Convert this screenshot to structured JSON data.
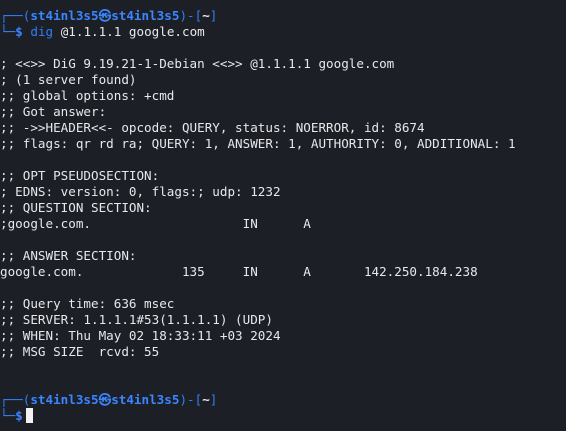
{
  "prompt": {
    "user": "st4inl3s5",
    "at_symbol": "㉿",
    "host": "st4inl3s5",
    "cwd": "~",
    "dollar": "$"
  },
  "command": {
    "binary": "dig",
    "args": " @1.1.1.1 google.com"
  },
  "output": {
    "l01": "; <<>> DiG 9.19.21-1-Debian <<>> @1.1.1.1 google.com",
    "l02": "; (1 server found)",
    "l03": ";; global options: +cmd",
    "l04": ";; Got answer:",
    "l05": ";; ->>HEADER<<- opcode: QUERY, status: NOERROR, id: 8674",
    "l06": ";; flags: qr rd ra; QUERY: 1, ANSWER: 1, AUTHORITY: 0, ADDITIONAL: 1",
    "l07": ";; OPT PSEUDOSECTION:",
    "l08": "; EDNS: version: 0, flags:; udp: 1232",
    "l09": ";; QUESTION SECTION:",
    "l10": ";google.com.                    IN      A",
    "l11": ";; ANSWER SECTION:",
    "l12": "google.com.             135     IN      A       142.250.184.238",
    "l13": ";; Query time: 636 msec",
    "l14": ";; SERVER: 1.1.1.1#53(1.1.1.1) (UDP)",
    "l15": ";; WHEN: Thu May 02 18:33:11 +03 2024",
    "l16": ";; MSG SIZE  rcvd: 55"
  },
  "colors": {
    "background": "#1d1f27",
    "prompt_frame": "#2f7ff2",
    "prompt_user": "#3a86ff",
    "text": "#e8e8ea"
  }
}
